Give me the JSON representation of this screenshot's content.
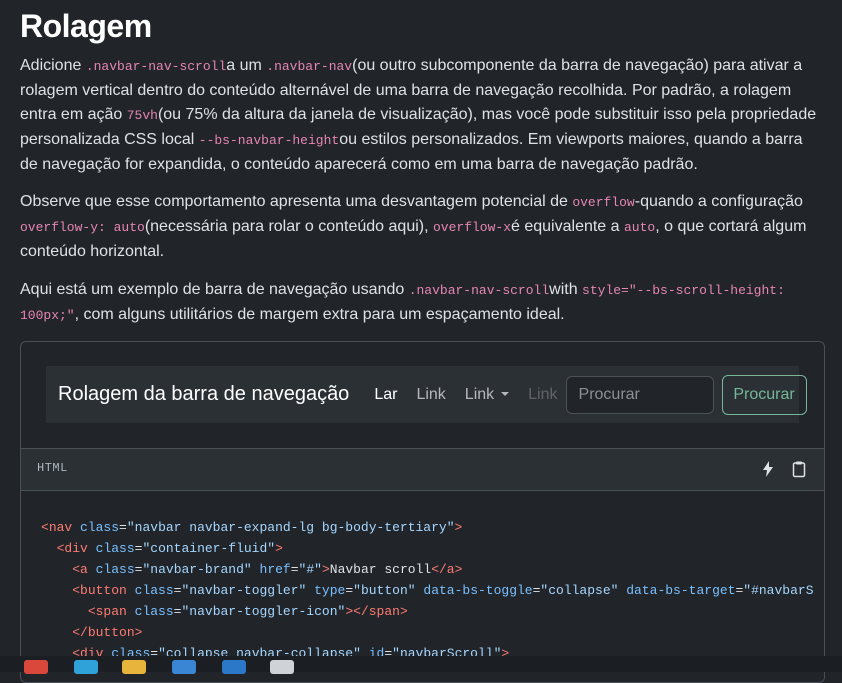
{
  "heading": "Rolagem",
  "para1": {
    "t1": "Adicione ",
    "c1": ".navbar-nav-scroll",
    "t2": "a um ",
    "c2": ".navbar-nav",
    "t3": "(ou outro subcomponente da barra de navegação) para ativar a rolagem vertical dentro do conteúdo alternável de uma barra de navegação recolhida. Por padrão, a rolagem entra em ação ",
    "c3": "75vh",
    "t4": "(ou 75% da altura da janela de visualização), mas você pode substituir isso pela propriedade personalizada CSS local ",
    "c4": "--bs-navbar-height",
    "t5": "ou estilos personalizados. Em viewports maiores, quando a barra de navegação for expandida, o conteúdo aparecerá como em uma barra de navegação padrão."
  },
  "para2": {
    "t1": "Observe que esse comportamento apresenta uma desvantagem potencial de ",
    "c1": "overflow",
    "t2": "-quando a configuração ",
    "c2": "overflow-y: auto",
    "t3": "(necessária para rolar o conteúdo aqui), ",
    "c3": "overflow-x",
    "t4": "é equivalente a ",
    "c4": "auto",
    "t5": ", o que cortará algum conteúdo horizontal."
  },
  "para3": {
    "t1": "Aqui está um exemplo de barra de navegação usando ",
    "c1": ".navbar-nav-scroll",
    "t2": "with ",
    "c2": "style=\"--bs-scroll-height: 100px;\"",
    "t3": ", com alguns utilitários de margem extra para um espaçamento ideal."
  },
  "example_navbar": {
    "brand": "Rolagem da barra de navegação",
    "links": {
      "home": "Lar",
      "link": "Link",
      "dropdown": "Link",
      "disabled": "Link"
    },
    "search_placeholder": "Procurar",
    "search_button": "Procurar"
  },
  "code": {
    "language": "HTML",
    "tools": [
      "lightning-icon",
      "clipboard-icon"
    ],
    "l1": {
      "tag": "nav",
      "a1": "class",
      "v1": "\"navbar navbar-expand-lg bg-body-tertiary\""
    },
    "l2": {
      "tag": "div",
      "a1": "class",
      "v1": "\"container-fluid\""
    },
    "l3": {
      "tag": "a",
      "a1": "class",
      "v1": "\"navbar-brand\"",
      "a2": "href",
      "v2": "\"#\"",
      "text": "Navbar scroll",
      "close": "a"
    },
    "l4": {
      "tag": "button",
      "a1": "class",
      "v1": "\"navbar-toggler\"",
      "a2": "type",
      "v2": "\"button\"",
      "a3": "data-bs-toggle",
      "v3": "\"collapse\"",
      "a4": "data-bs-target",
      "v4": "\"#navbarS"
    },
    "l5": {
      "tag": "span",
      "a1": "class",
      "v1": "\"navbar-toggler-icon\"",
      "close": "span"
    },
    "l6": {
      "close": "button"
    },
    "l7": {
      "tag": "div",
      "a1": "class",
      "v1": "\"collapse navbar-collapse\"",
      "a2": "id",
      "v2": "\"navbarScroll\""
    }
  },
  "colors": {
    "background": "#212529",
    "code_pink": "#e685b5",
    "success": "#75b798",
    "tag": "#ff7b72",
    "attr": "#79c0ff",
    "value": "#a5d6ff"
  }
}
